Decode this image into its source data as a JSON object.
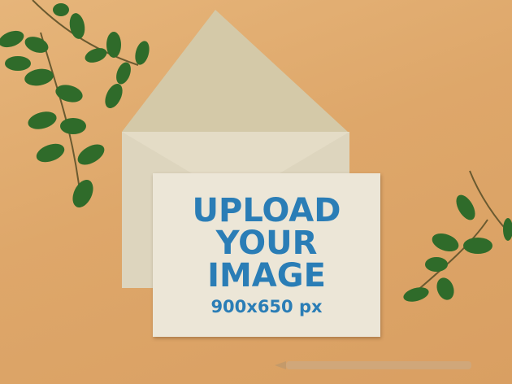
{
  "card": {
    "line1": "UPLOAD",
    "line2": "YOUR",
    "line3": "IMAGE",
    "size": "900x650 px"
  },
  "colors": {
    "text": "#2a7db6",
    "card": "#ece6d7",
    "envelope": "#dcd3bb",
    "wood": "#dea76a",
    "leaf": "#2f6b2a"
  }
}
